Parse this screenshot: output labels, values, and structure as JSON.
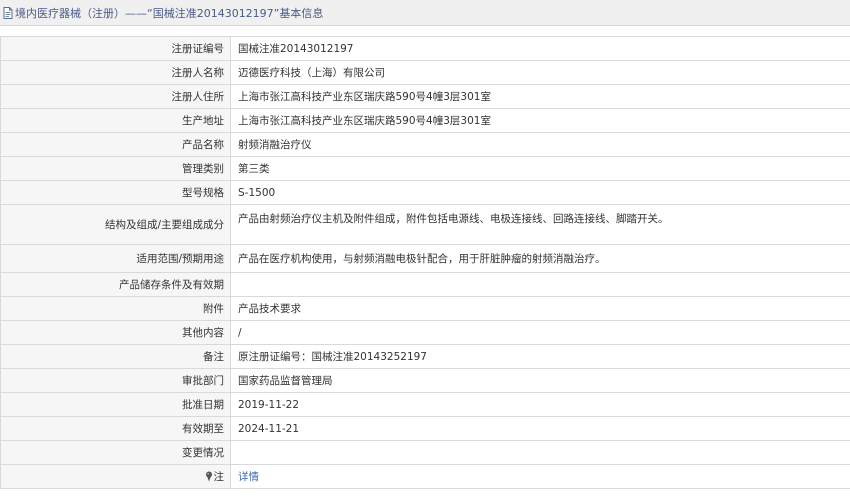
{
  "header": {
    "title": "境内医疗器械（注册）——“国械注准20143012197”基本信息"
  },
  "rows": [
    {
      "label": "注册证编号",
      "value": "国械注准20143012197"
    },
    {
      "label": "注册人名称",
      "value": "迈德医疗科技（上海）有限公司"
    },
    {
      "label": "注册人住所",
      "value": "上海市张江高科技产业东区瑞庆路590号4幢3层301室"
    },
    {
      "label": "生产地址",
      "value": "上海市张江高科技产业东区瑞庆路590号4幢3层301室"
    },
    {
      "label": "产品名称",
      "value": "射频消融治疗仪"
    },
    {
      "label": "管理类别",
      "value": "第三类"
    },
    {
      "label": "型号规格",
      "value": "S-1500"
    },
    {
      "label": "结构及组成/主要组成成分",
      "value": "产品由射频治疗仪主机及附件组成，附件包括电源线、电极连接线、回路连接线、脚踏开关。"
    },
    {
      "label": "适用范围/预期用途",
      "value": "产品在医疗机构使用，与射频消融电极针配合，用于肝脏肿瘤的射频消融治疗。"
    },
    {
      "label": "产品储存条件及有效期",
      "value": ""
    },
    {
      "label": "附件",
      "value": "产品技术要求"
    },
    {
      "label": "其他内容",
      "value": "/"
    },
    {
      "label": "备注",
      "value": "原注册证编号：国械注准20143252197"
    },
    {
      "label": "审批部门",
      "value": "国家药品监督管理局"
    },
    {
      "label": "批准日期",
      "value": "2019-11-22"
    },
    {
      "label": "有效期至",
      "value": "2024-11-21"
    },
    {
      "label": "变更情况",
      "value": ""
    },
    {
      "label": "注",
      "value": "详情"
    }
  ],
  "icons": {
    "header_icon": "document-icon",
    "note_icon": "pin-icon"
  }
}
